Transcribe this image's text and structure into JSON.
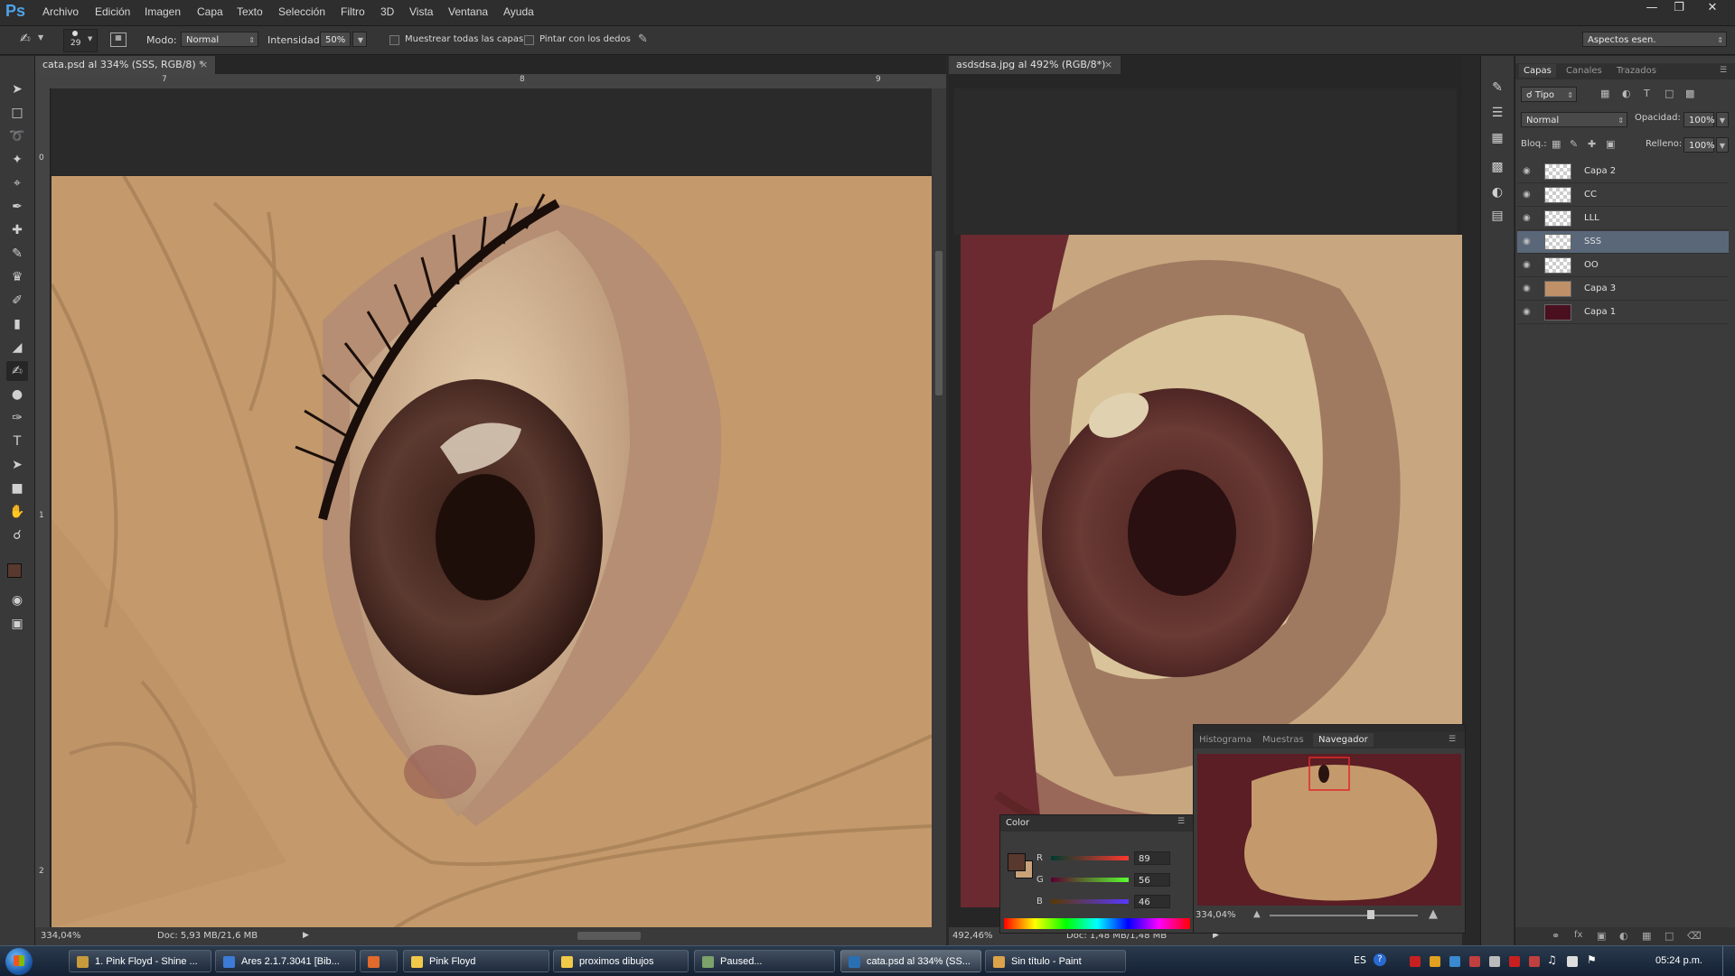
{
  "app": {
    "logo": "Ps"
  },
  "menu": [
    "Archivo",
    "Edición",
    "Imagen",
    "Capa",
    "Texto",
    "Selección",
    "Filtro",
    "3D",
    "Vista",
    "Ventana",
    "Ayuda"
  ],
  "options": {
    "brush_size": "29",
    "mode_label": "Modo:",
    "mode_value": "Normal",
    "intensity_label": "Intensidad:",
    "intensity_value": "50%",
    "sample_all_label": "Muestrear todas las capas",
    "finger_paint_label": "Pintar con los dedos",
    "workspace": "Aspectos esen."
  },
  "doc1": {
    "tab": "cata.psd al 334% (SSS, RGB/8) *",
    "ruler_marks": [
      "7",
      "8",
      "9"
    ],
    "vruler_marks": [
      "0",
      "1",
      "2"
    ],
    "zoom": "334,04%",
    "docsize": "Doc: 5,93 MB/21,6 MB"
  },
  "doc2": {
    "tab": "asdsdsa.jpg al 492% (RGB/8*)",
    "zoom": "492,46%",
    "docsize": "Doc: 1,48 MB/1,48 MB"
  },
  "layers_panel": {
    "tabs": [
      "Capas",
      "Canales",
      "Trazados"
    ],
    "filter": "Tipo",
    "blend": "Normal",
    "opacity_label": "Opacidad:",
    "opacity_value": "100%",
    "lock_label": "Bloq.:",
    "fill_label": "Relleno:",
    "fill_value": "100%",
    "layers": [
      {
        "name": "Capa 2",
        "thumb": "checker",
        "selected": false
      },
      {
        "name": "CC",
        "thumb": "checker",
        "selected": false
      },
      {
        "name": "LLL",
        "thumb": "checker",
        "selected": false
      },
      {
        "name": "SSS",
        "thumb": "checker",
        "selected": true
      },
      {
        "name": "OO",
        "thumb": "checker",
        "selected": false
      },
      {
        "name": "Capa 3",
        "thumb": "#c09068",
        "selected": false
      },
      {
        "name": "Capa 1",
        "thumb": "#4a1020",
        "selected": false
      }
    ]
  },
  "navigator": {
    "tabs": [
      "Histograma",
      "Muestras",
      "Navegador"
    ],
    "zoom": "334,04%"
  },
  "color_panel": {
    "title": "Color",
    "r_label": "R",
    "r_value": "89",
    "g_label": "G",
    "g_value": "56",
    "b_label": "B",
    "b_value": "46",
    "fg_color": "#59382e"
  },
  "taskbar": {
    "buttons": [
      {
        "label": "1. Pink Floyd - Shine ...",
        "icon_color": "#c79a3b"
      },
      {
        "label": "Ares 2.1.7.3041 [Bib...",
        "icon_color": "#3c7bd6"
      },
      {
        "label": "",
        "icon_color": "#e26a2c"
      },
      {
        "label": "Pink Floyd",
        "icon_color": "#f0c84a"
      },
      {
        "label": "proximos dibujos",
        "icon_color": "#f0c84a"
      },
      {
        "label": "Paused...",
        "icon_color": "#7aa26a"
      },
      {
        "label": "cata.psd al 334% (SS...",
        "icon_color": "#2b6fb3"
      },
      {
        "label": "Sin título - Paint",
        "icon_color": "#dca34a"
      }
    ],
    "lang": "ES",
    "clock": "05:24 p.m."
  },
  "colors": {
    "accent_selected_layer": "#596779",
    "skin": "#c49a6c"
  }
}
